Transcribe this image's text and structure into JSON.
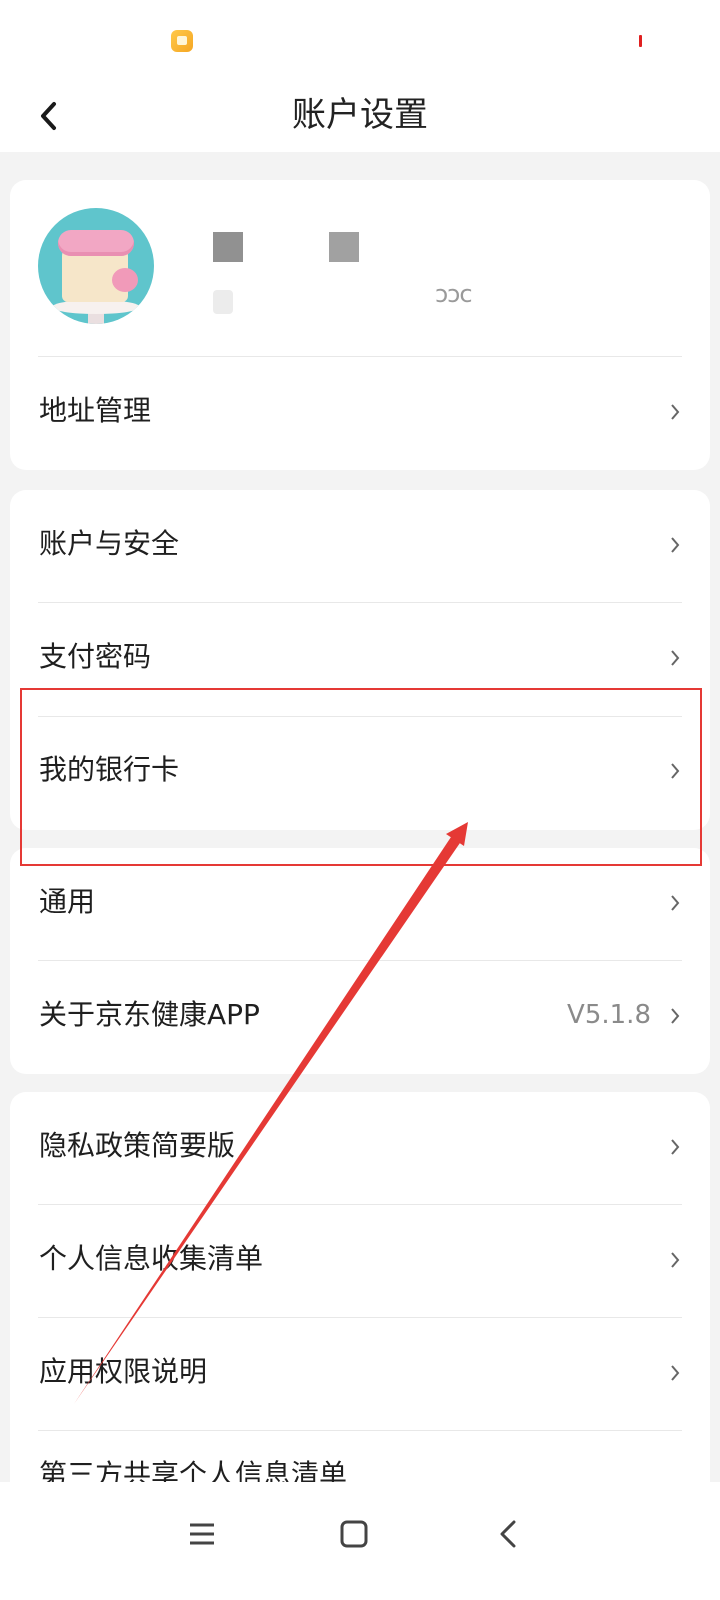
{
  "header": {
    "title": "账户设置"
  },
  "profile": {
    "sub_fragment": "ɔɔc"
  },
  "sections": [
    {
      "items": [
        {
          "label": "地址管理"
        }
      ]
    },
    {
      "items": [
        {
          "label": "账户与安全"
        },
        {
          "label": "支付密码"
        },
        {
          "label": "我的银行卡"
        }
      ]
    },
    {
      "items": [
        {
          "label": "通用"
        },
        {
          "label": "关于京东健康APP",
          "value": "V5.1.8"
        }
      ]
    },
    {
      "items": [
        {
          "label": "隐私政策简要版"
        },
        {
          "label": "个人信息收集清单"
        },
        {
          "label": "应用权限说明"
        },
        {
          "label": "第三方共享个人信息清单"
        }
      ]
    }
  ],
  "icons": {
    "back": "chevron-left-icon",
    "row_arrow": "chevron-right-icon",
    "nav_menu": "menu-icon",
    "nav_home": "square-icon",
    "nav_back": "back-icon"
  },
  "colors": {
    "annotation": "#e53935",
    "accent_bg": "#f3f3f3"
  }
}
